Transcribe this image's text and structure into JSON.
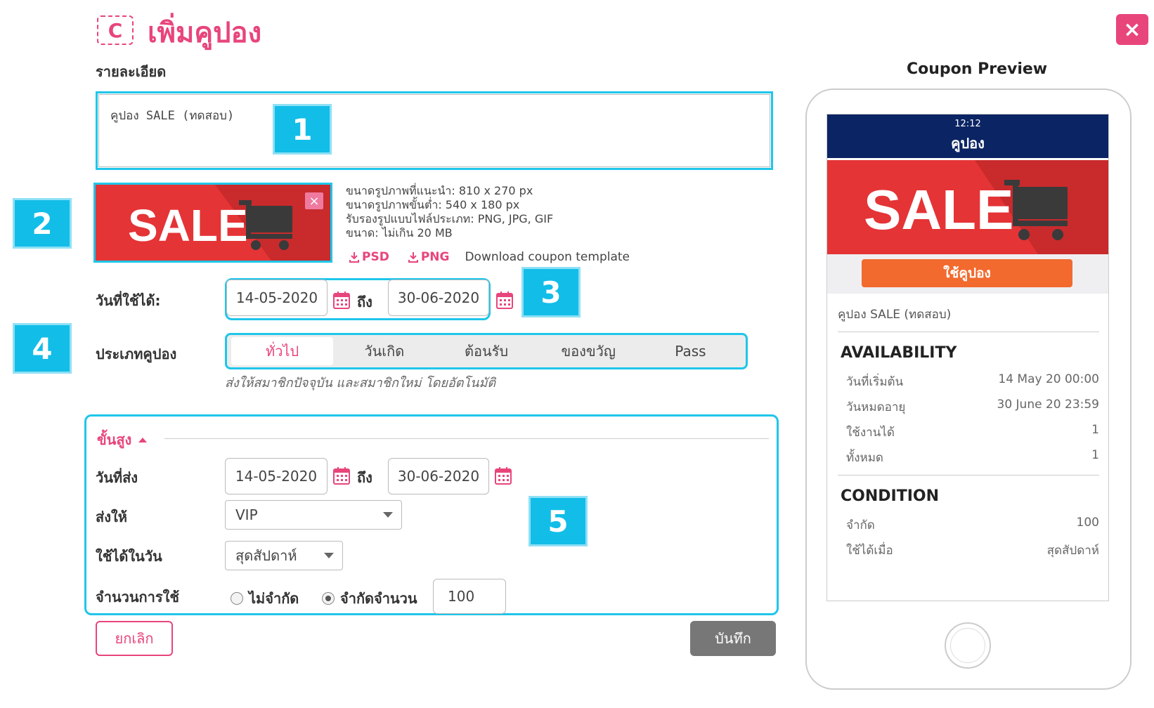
{
  "header": {
    "icon_letter": "C",
    "title": "เพิ่มคูปอง",
    "close": "×"
  },
  "form": {
    "details_label": "รายละเอียด",
    "description_value": "คูปอง SALE (ทดสอบ)",
    "image": {
      "banner_text": "SALE",
      "remove": "×",
      "info": [
        "ขนาดรูปภาพที่แนะนำ: 810 x 270 px",
        "ขนาดรูปภาพขั้นต่ำ: 540 x 180 px",
        "รับรองรูปแบบไฟล์ประเภท: PNG, JPG, GIF",
        "ขนาด: ไม่เกิน 20 MB"
      ],
      "psd": "PSD",
      "png": "PNG",
      "download_text": "Download coupon template"
    },
    "valid_dates": {
      "label": "วันที่ใช้ได้:",
      "start": "14-05-2020",
      "to": "ถึง",
      "end": "30-06-2020"
    },
    "coupon_type": {
      "label": "ประเภทคูปอง",
      "options": [
        "ทั่วไป",
        "วันเกิด",
        "ต้อนรับ",
        "ของขวัญ",
        "Pass"
      ],
      "hint": "ส่งให้สมาชิกปัจจุบัน และสมาชิกใหม่ โดยอัตโนมัติ"
    },
    "advanced": {
      "label": "ขั้นสูง",
      "send_date_label": "วันที่ส่ง",
      "send_start": "14-05-2020",
      "to": "ถึง",
      "send_end": "30-06-2020",
      "send_to_label": "ส่งให้",
      "send_to_value": "VIP",
      "usable_day_label": "ใช้ได้ในวัน",
      "usable_day_value": "สุดสัปดาห์",
      "usage_label": "จำนวนการใช้",
      "unlimited": "ไม่จำกัด",
      "limited": "จำกัดจำนวน",
      "limit_value": "100"
    },
    "cancel": "ยกเลิก",
    "save": "บันทึก"
  },
  "badges": [
    "1",
    "2",
    "3",
    "4",
    "5"
  ],
  "preview": {
    "title": "Coupon Preview",
    "time": "12:12",
    "screen_title": "คูปอง",
    "banner_text": "SALE",
    "use_button": "ใช้คูปอง",
    "coupon_name": "คูปอง SALE (ทดสอบ)",
    "availability": {
      "heading": "AVAILABILITY",
      "rows": [
        {
          "label": "วันที่เริ่มต้น",
          "value": "14 May 20 00:00"
        },
        {
          "label": "วันหมดอายุ",
          "value": "30 June 20 23:59"
        },
        {
          "label": "ใช้งานได้",
          "value": "1"
        },
        {
          "label": "ทั้งหมด",
          "value": "1"
        }
      ]
    },
    "condition": {
      "heading": "CONDITION",
      "rows": [
        {
          "label": "จำกัด",
          "value": "100"
        },
        {
          "label": "ใช้ได้เมื่อ",
          "value": "สุดสัปดาห์"
        }
      ]
    }
  },
  "colors": {
    "accent": "#e8457b",
    "highlight": "#1fc6ea",
    "sale_red": "#e43436",
    "preview_header": "#0b2463",
    "use_button": "#f26a2e"
  }
}
